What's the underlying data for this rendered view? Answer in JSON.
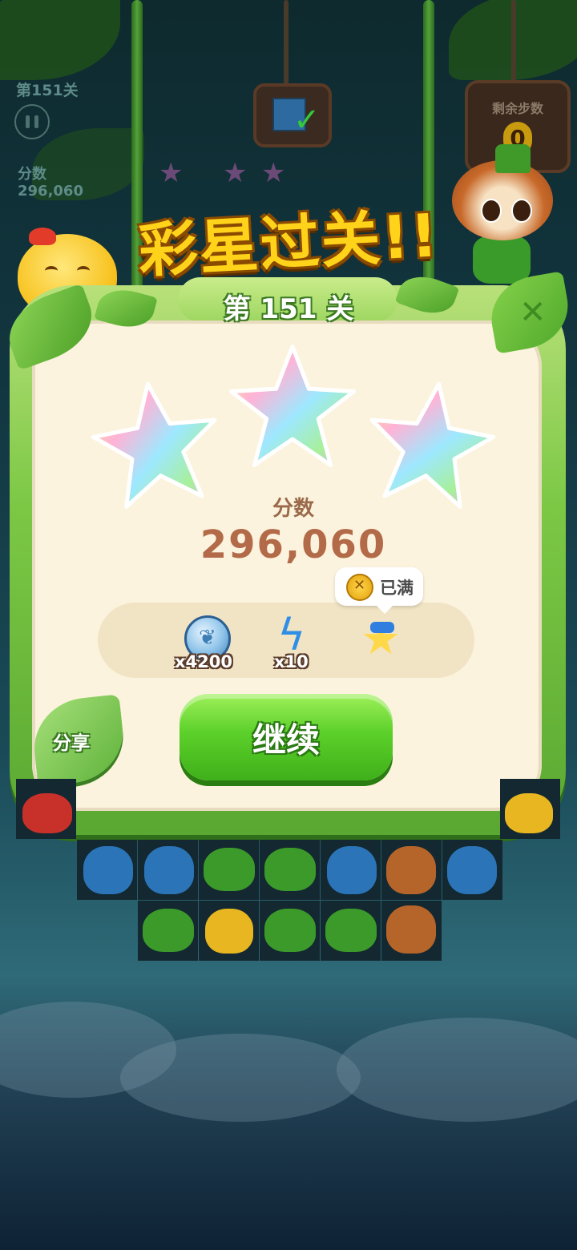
{
  "hud": {
    "level": "第151关",
    "score_label": "分数",
    "score": "296,060",
    "moves_label": "剩余步数",
    "moves": "0"
  },
  "banner": {
    "title": "彩星过关!!"
  },
  "dialog": {
    "level": "第 151 关",
    "stars_earned": 3,
    "stars_total": 3,
    "score_label": "分数",
    "score": "296,060",
    "rewards": [
      {
        "icon": "silver-coin-icon",
        "count": "x4200"
      },
      {
        "icon": "lightning-icon",
        "count": "x10"
      },
      {
        "icon": "star-bottle-icon"
      }
    ],
    "tooltip": {
      "icon": "gold-coin-icon",
      "text": "已满"
    },
    "continue_label": "继续",
    "share_label": "分享"
  },
  "colors": {
    "title": "#ffd31a",
    "continue_button": "#5cd02a",
    "dialog_frame": "#7cc845",
    "dialog_panel": "#fbf3dd",
    "score_text": "#b26a48"
  }
}
